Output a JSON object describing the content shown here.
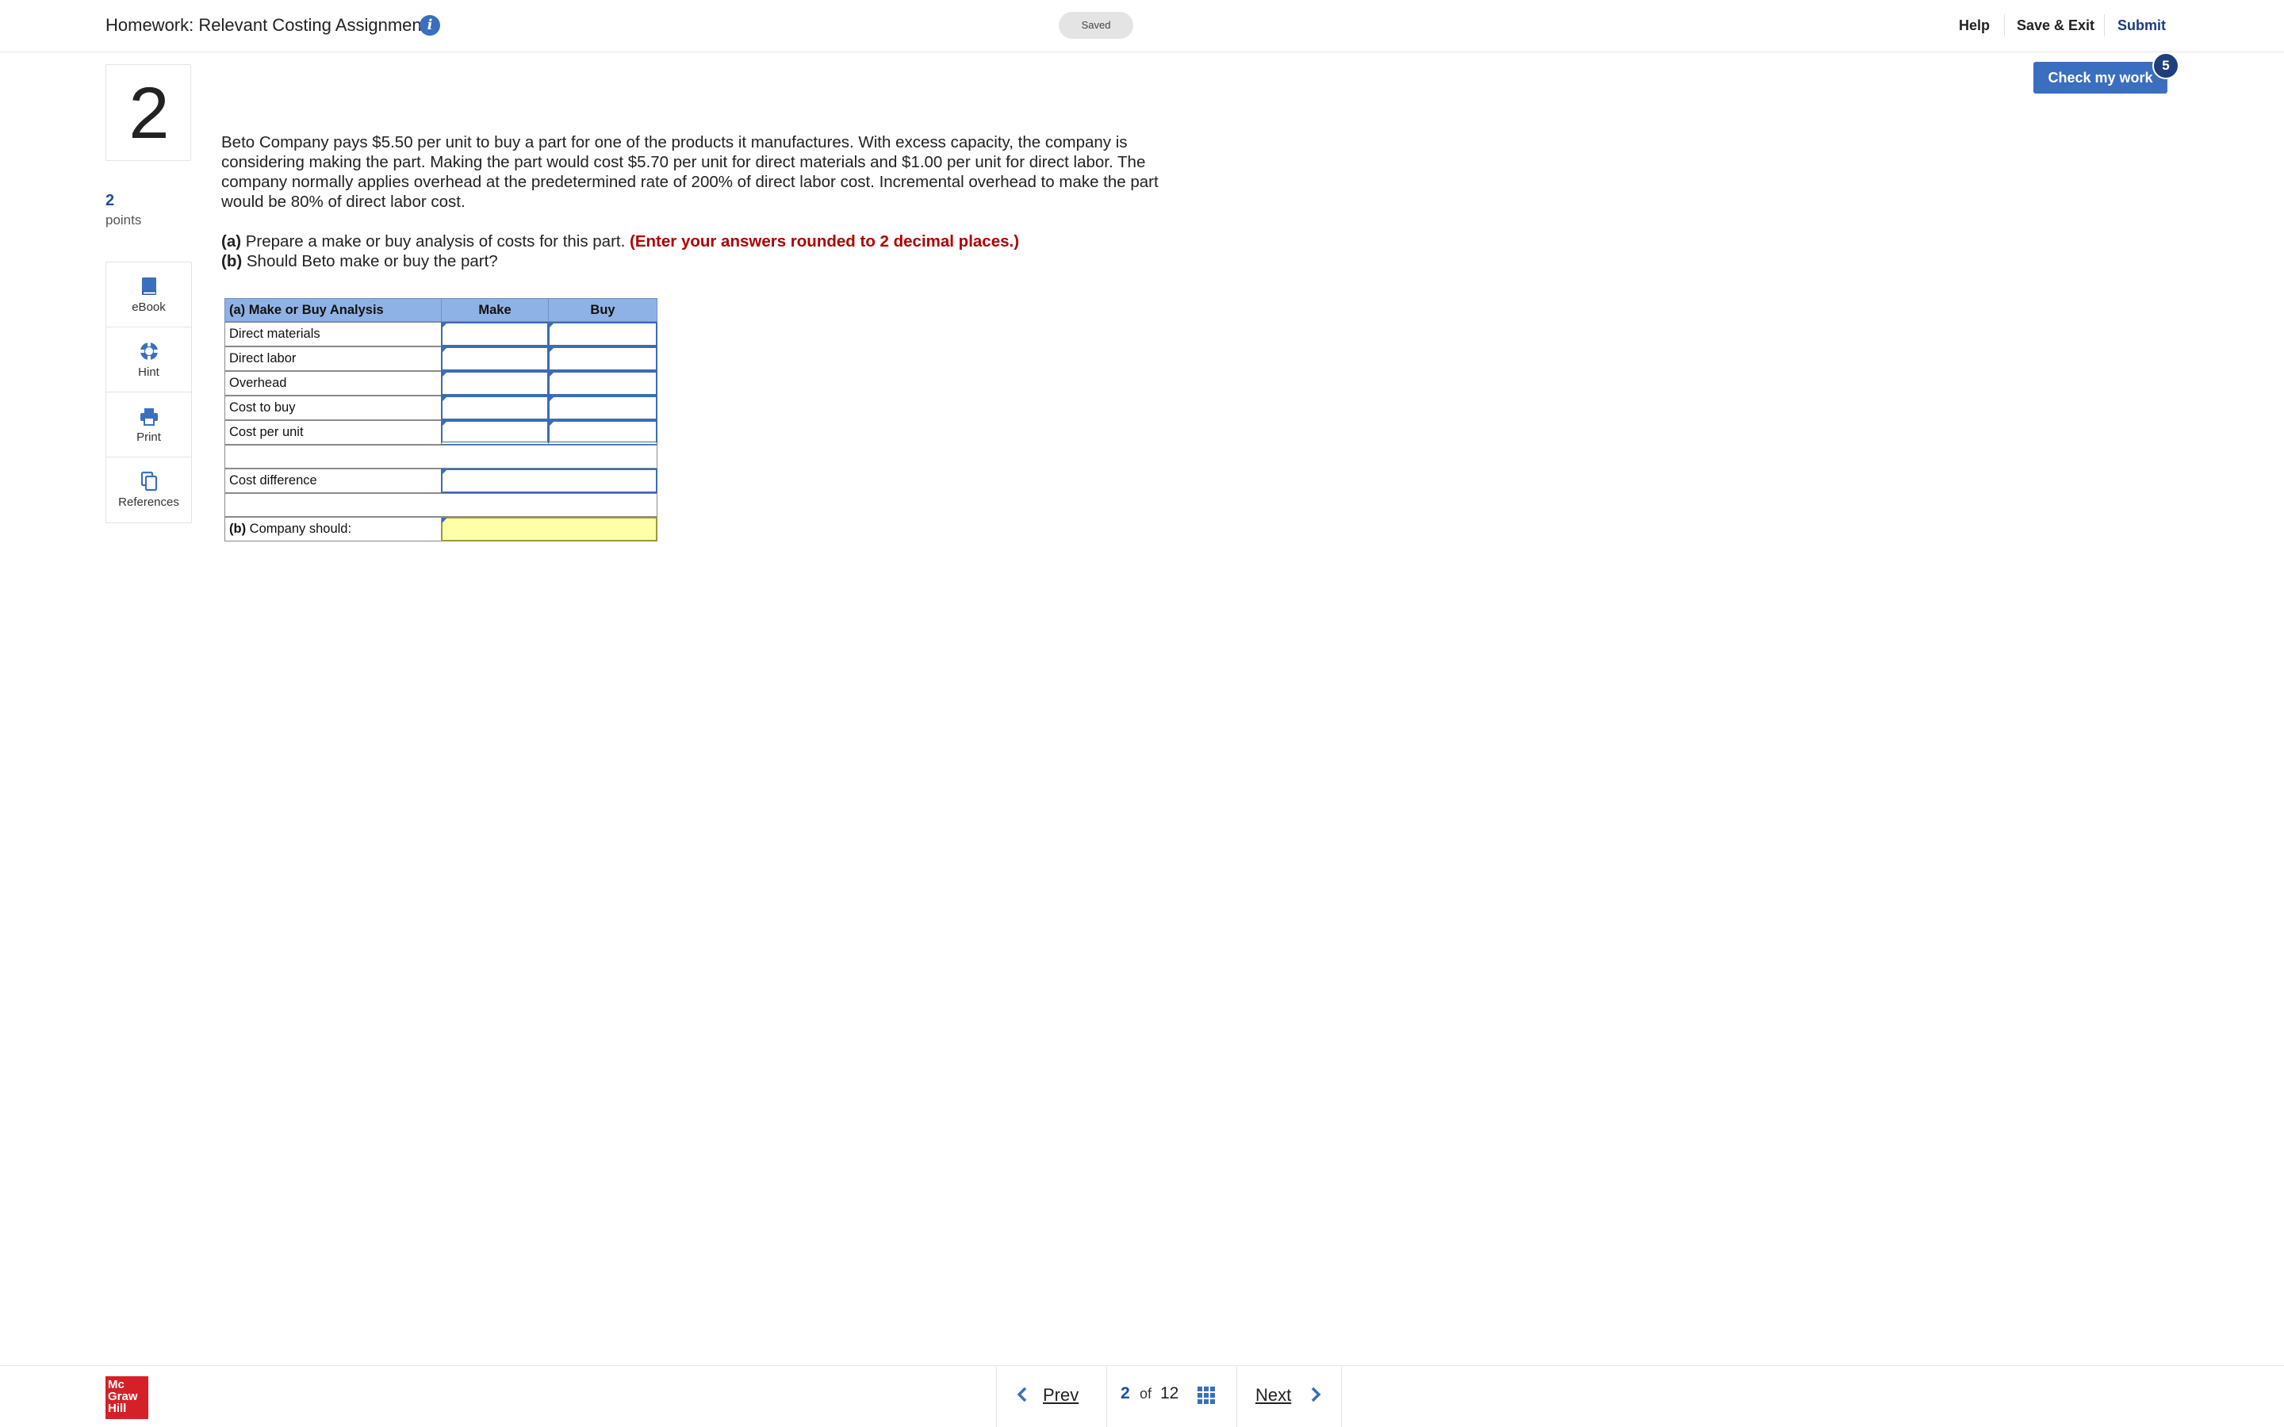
{
  "header": {
    "title": "Homework: Relevant Costing Assignment",
    "info_icon": "info-icon",
    "saved_status": "Saved",
    "help": "Help",
    "save_exit": "Save & Exit",
    "submit": "Submit"
  },
  "question": {
    "number": "2",
    "points": "2",
    "points_label": "points",
    "text": "Beto Company pays $5.50 per unit to buy a part for one of the products it manufactures. With excess capacity, the company is considering making the part. Making the part would cost $5.70 per unit for direct materials and $1.00 per unit for direct labor. The company normally applies overhead at the predetermined rate of 200% of direct labor cost. Incremental overhead to make the part would be 80% of direct labor cost.",
    "part_a_label": "(a)",
    "part_a_text": " Prepare a make or buy analysis of costs for this part. ",
    "part_a_note": "(Enter your answers rounded to 2 decimal places.)",
    "part_b_label": "(b)",
    "part_b_text": " Should Beto make or buy the part?"
  },
  "tools": [
    {
      "label": "eBook",
      "icon": "book-icon"
    },
    {
      "label": "Hint",
      "icon": "lifebuoy-icon"
    },
    {
      "label": "Print",
      "icon": "printer-icon"
    },
    {
      "label": "References",
      "icon": "copy-icon"
    }
  ],
  "check_work": {
    "label": "Check my work",
    "badge": "5"
  },
  "worksheet": {
    "header": {
      "label": "(a) Make or Buy Analysis",
      "make": "Make",
      "buy": "Buy"
    },
    "rows": [
      {
        "label": "Direct materials",
        "make": "",
        "buy": ""
      },
      {
        "label": "Direct labor",
        "make": "",
        "buy": ""
      },
      {
        "label": "Overhead",
        "make": "",
        "buy": ""
      },
      {
        "label": "Cost to buy",
        "make": "",
        "buy": ""
      },
      {
        "label": "Cost per unit",
        "make": "",
        "buy": ""
      }
    ],
    "cost_difference_label": "Cost difference",
    "cost_difference_value": "",
    "company_should_bold": "(b)",
    "company_should_label": " Company should:",
    "company_should_value": ""
  },
  "footer": {
    "logo_line1": "Mc",
    "logo_line2": "Graw",
    "logo_line3": "Hill",
    "prev": "Prev",
    "current_page": "2",
    "of": "of",
    "total_pages": "12",
    "next": "Next"
  },
  "colors": {
    "accent": "#3a6fbf",
    "badge": "#1f3f7a",
    "instruction_red": "#b00000",
    "table_header": "#8fb2e6",
    "answer_yellow": "#ffffa8",
    "logo_red": "#d62027"
  }
}
